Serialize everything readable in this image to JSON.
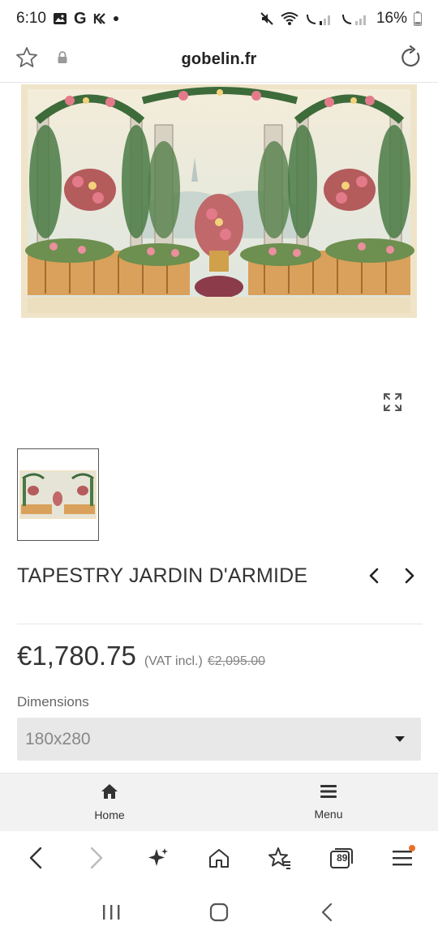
{
  "status_bar": {
    "time": "6:10",
    "battery": "16%",
    "left_icons": [
      "image-icon",
      "google-icon",
      "k-icon",
      "dot-icon"
    ],
    "right_icons": [
      "mute-icon",
      "wifi-icon",
      "signal-1-icon",
      "signal-2-icon",
      "battery-icon"
    ]
  },
  "url_bar": {
    "domain": "gobelin.fr"
  },
  "product": {
    "title": "TAPESTRY JARDIN D'ARMIDE",
    "price": "€1,780.75",
    "vat_note": "(VAT incl.)",
    "old_price": "€2,095.00"
  },
  "dimensions": {
    "label": "Dimensions",
    "selected": "180x280"
  },
  "site_nav": {
    "home_label": "Home",
    "menu_label": "Menu"
  },
  "browser_toolbar": {
    "tabs_count": "89"
  },
  "colors": {
    "accent_dot": "#e8702a",
    "select_bg": "#e8e8e8",
    "site_nav_bg": "#f2f2f2"
  }
}
